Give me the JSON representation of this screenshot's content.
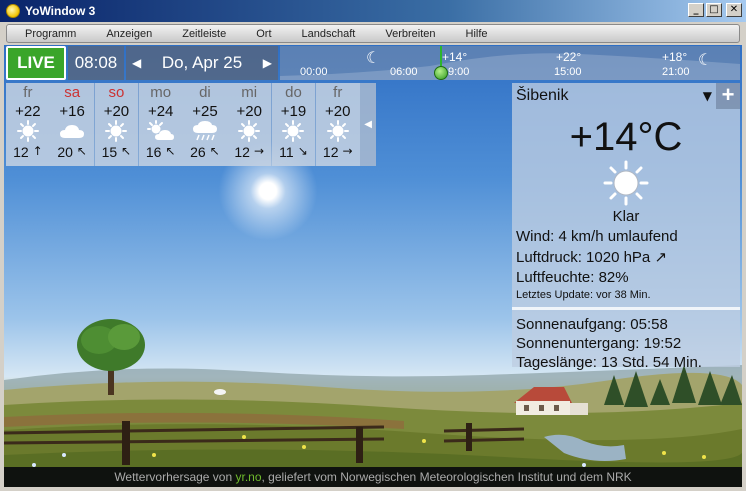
{
  "window": {
    "title": "YoWindow 3",
    "minimize": "_",
    "maximize": "□",
    "close": "✕"
  },
  "menu": [
    "Programm",
    "Anzeigen",
    "Zeitleiste",
    "Ort",
    "Landschaft",
    "Verbreiten",
    "Hilfe"
  ],
  "topbar": {
    "live": "LIVE",
    "time": "08:08",
    "date": "Do, Apr 25",
    "prev_arrow": "◀",
    "next_arrow": "▶"
  },
  "timeline": {
    "times": [
      "00:00",
      "06:00",
      "9:00",
      "15:00",
      "21:00"
    ],
    "temps": [
      "+14°",
      "+22°",
      "+18°"
    ]
  },
  "forecast": [
    {
      "day": "fr",
      "weekend": false,
      "temp": "+22",
      "icon": "sun-icon",
      "wind": "12",
      "arrow": "↑"
    },
    {
      "day": "sa",
      "weekend": true,
      "temp": "+16",
      "icon": "cloud-icon",
      "wind": "20",
      "arrow": "↖"
    },
    {
      "day": "so",
      "weekend": true,
      "temp": "+20",
      "icon": "sun-icon",
      "wind": "15",
      "arrow": "↖"
    },
    {
      "day": "mo",
      "weekend": false,
      "temp": "+24",
      "icon": "partly-cloudy-icon",
      "wind": "16",
      "arrow": "↖"
    },
    {
      "day": "di",
      "weekend": false,
      "temp": "+25",
      "icon": "rain-icon",
      "wind": "26",
      "arrow": "↖"
    },
    {
      "day": "mi",
      "weekend": false,
      "temp": "+20",
      "icon": "sun-icon",
      "wind": "12",
      "arrow": "→"
    },
    {
      "day": "do",
      "weekend": false,
      "temp": "+19",
      "icon": "sun-icon",
      "wind": "11",
      "arrow": "↘"
    },
    {
      "day": "fr",
      "weekend": false,
      "temp": "+20",
      "icon": "sun-icon",
      "wind": "12",
      "arrow": "→"
    }
  ],
  "forecast_collapse": "◀",
  "current": {
    "location": "Šibenik",
    "dropdown": "▼",
    "add": "+",
    "temperature": "+14°C",
    "condition": "Klar",
    "wind_label": "Wind:",
    "wind_value": "4 km/h umlaufend",
    "pressure_label": "Luftdruck:",
    "pressure_value": "1020 hPa",
    "pressure_trend": "↗",
    "humidity_label": "Luftfeuchte:",
    "humidity_value": "82%",
    "updated_label": "Letztes Update:",
    "updated_value": "vor 38 Min.",
    "sunrise_label": "Sonnenaufgang:",
    "sunrise_value": "05:58",
    "sunset_label": "Sonnenuntergang:",
    "sunset_value": "19:52",
    "daylength_label": "Tageslänge:",
    "daylength_value": "13 Std. 54 Min."
  },
  "footer": {
    "prefix": "Wettervorhersage von ",
    "link": "yr.no",
    "suffix": ", geliefert vom Norwegischen Meteorologischen Institut und dem NRK"
  },
  "colors": {
    "live_green": "#3aa52a",
    "link_green": "#6fba2c",
    "weekend_red": "#c33333"
  }
}
